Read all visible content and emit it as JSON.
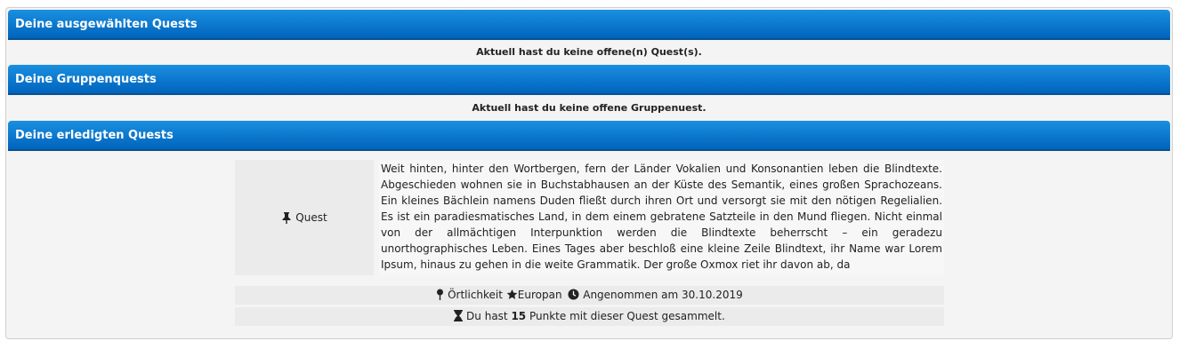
{
  "sections": {
    "selected": {
      "title": "Deine ausgewählten Quests",
      "empty_message": "Aktuell hast du keine offene(n) Quest(s)."
    },
    "group": {
      "title": "Deine Gruppenquests",
      "empty_message": "Aktuell hast du keine offene Gruppenuest."
    },
    "completed": {
      "title": "Deine erledigten Quests",
      "quest": {
        "type_label": "Quest",
        "description": "Weit hinten, hinter den Wortbergen, fern der Länder Vokalien und Konsonantien leben die Blindtexte. Abgeschieden wohnen sie in Buchstabhausen an der Küste des Semantik, eines großen Sprachozeans. Ein kleines Bächlein namens Duden fließt durch ihren Ort und versorgt sie mit den nötigen Regelialien. Es ist ein paradiesmatisches Land, in dem einem gebratene Satzteile in den Mund fliegen. Nicht einmal von der allmächtigen Interpunktion werden die Blindtexte beherrscht – ein geradezu unorthographisches Leben. Eines Tages aber beschloß eine kleine Zeile Blindtext, ihr Name war Lorem Ipsum, hinaus zu gehen in die weite Grammatik. Der große Oxmox riet ihr davon ab, da",
        "location_label": "Örtlichkeit",
        "location_value": "Europan",
        "accepted_text": "Angenommen am 30.10.2019",
        "points_prefix": "Du hast",
        "points_value": "15",
        "points_suffix": "Punkte mit dieser Quest gesammelt."
      }
    }
  },
  "icons": {
    "pin": "pushpin-icon",
    "location": "map-marker-icon",
    "star": "star-icon",
    "clock": "clock-icon",
    "hourglass": "hourglass-icon"
  },
  "colors": {
    "header_top": "#1a8fe0",
    "header_bottom": "#0064bd"
  }
}
